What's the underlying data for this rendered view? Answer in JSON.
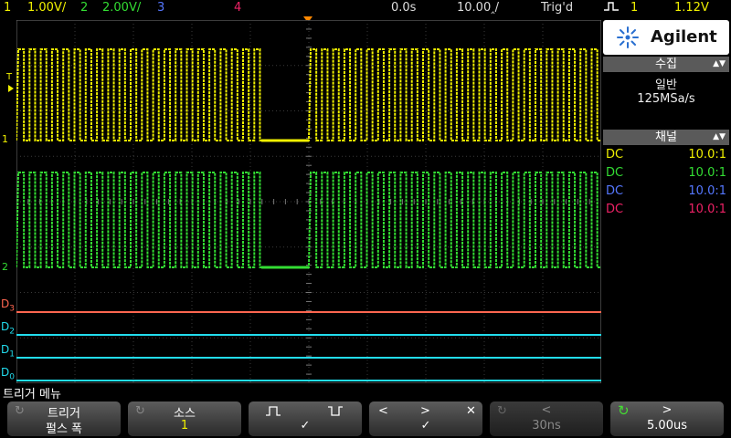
{
  "status_bar": {
    "ch1_label": "1",
    "ch1_scale": "1.00V/",
    "ch2_label": "2",
    "ch2_scale": "2.00V/",
    "ch3_label": "3",
    "ch4_label": "4",
    "time_pos": "0.0s",
    "time_scale": "10.00‸/",
    "trigger_status": "Trig'd",
    "trigger_source": "1",
    "trigger_level": "1.12V"
  },
  "colors": {
    "ch1": "#f0f000",
    "ch2": "#33dd33",
    "ch3": "#5577ff",
    "ch4": "#ee2266",
    "d3": "#ff6650",
    "digital": "#22ddee",
    "trigger_marker": "#ff8800"
  },
  "side_panel": {
    "brand": "Agilent",
    "acquire_header": "수집",
    "acquire_mode": "일반",
    "sample_rate": "125MSa/s",
    "channel_header": "채널",
    "channels": [
      {
        "coupling": "DC",
        "probe": "10.0:1"
      },
      {
        "coupling": "DC",
        "probe": "10.0:1"
      },
      {
        "coupling": "DC",
        "probe": "10.0:1"
      },
      {
        "coupling": "DC",
        "probe": "10.0:1"
      }
    ]
  },
  "waveform_labels": {
    "ch1": "1",
    "ch2": "2",
    "trigger_level_marker": "T",
    "d3": "D",
    "d3_sub": "3",
    "d2": "D",
    "d2_sub": "2",
    "d1": "D",
    "d1_sub": "1",
    "d0": "D",
    "d0_sub": "0"
  },
  "menu": {
    "title": "트리거 메뉴",
    "softkeys": [
      {
        "top": "트리거",
        "bottom": "펄스 폭"
      },
      {
        "top": "소스",
        "bottom": "1"
      },
      {
        "top": "",
        "bottom": "✓"
      },
      {
        "top": "",
        "bottom": "✓"
      },
      {
        "top": "<",
        "bottom": "30ns"
      },
      {
        "top": ">",
        "bottom": "5.00us"
      }
    ]
  }
}
